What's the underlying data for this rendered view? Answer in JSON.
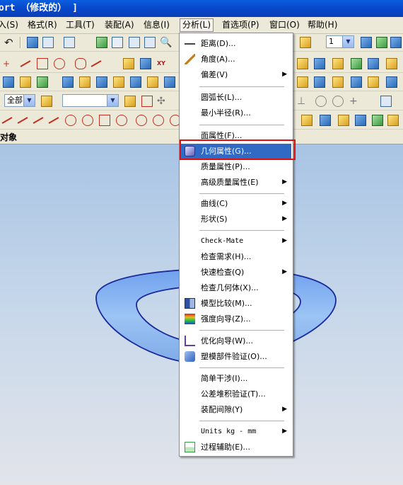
{
  "window": {
    "title": "ort （修改的） ]"
  },
  "menubar": {
    "items": [
      {
        "label": "入(S)"
      },
      {
        "label": "格式(R)"
      },
      {
        "label": "工具(T)"
      },
      {
        "label": "装配(A)"
      },
      {
        "label": "信息(I)"
      },
      {
        "label": "分析(L)"
      },
      {
        "label": "首选项(P)"
      },
      {
        "label": "窗口(O)"
      },
      {
        "label": "帮助(H)"
      }
    ]
  },
  "toolbar": {
    "layer_select": "1",
    "filter_select": "全部",
    "blank_select": ""
  },
  "tree": {
    "header": "对象"
  },
  "analysis_menu": {
    "items": [
      {
        "label": "距离(D)...",
        "icon": "distance-icon"
      },
      {
        "label": "角度(A)...",
        "icon": "angle-icon"
      },
      {
        "label": "偏差(V)",
        "icon": "",
        "submenu": "▶"
      },
      {
        "label": "圆弧长(L)...",
        "icon": ""
      },
      {
        "label": "最小半径(R)...",
        "icon": ""
      },
      {
        "label": "面属性(F)...",
        "icon": ""
      },
      {
        "label": "几何属性(G)...",
        "icon": "geometry-property-icon",
        "highlighted": true
      },
      {
        "label": "质量属性(P)...",
        "icon": ""
      },
      {
        "label": "高级质量属性(E)",
        "icon": "",
        "submenu": "▶"
      },
      {
        "label": "曲线(C)",
        "icon": "",
        "submenu": "▶"
      },
      {
        "label": "形状(S)",
        "icon": "",
        "submenu": "▶"
      },
      {
        "label": "Check-Mate",
        "icon": "",
        "submenu": "▶"
      },
      {
        "label": "检查需求(H)...",
        "icon": ""
      },
      {
        "label": "快速检查(Q)",
        "icon": "",
        "submenu": "▶"
      },
      {
        "label": "检查几何体(X)...",
        "icon": ""
      },
      {
        "label": "模型比较(M)...",
        "icon": "model-compare-icon"
      },
      {
        "label": "强度向导(Z)...",
        "icon": "strength-wizard-icon"
      },
      {
        "label": "优化向导(W)...",
        "icon": "optimization-wizard-icon"
      },
      {
        "label": "塑模部件验证(O)...",
        "icon": "mold-part-validation-icon"
      },
      {
        "label": "简单干涉(I)...",
        "icon": ""
      },
      {
        "label": "公差堆积验证(T)...",
        "icon": ""
      },
      {
        "label": "装配间隙(Y)",
        "icon": "",
        "submenu": "▶"
      },
      {
        "label": "Units kg - mm",
        "icon": "",
        "submenu": "▶"
      },
      {
        "label": "过程辅助(E)...",
        "icon": "process-assist-icon"
      }
    ]
  },
  "colors": {
    "highlight": "#316ac5",
    "callout": "#e01010",
    "part_fill": "#8fb8f0",
    "part_edge": "#1a2a9a"
  }
}
